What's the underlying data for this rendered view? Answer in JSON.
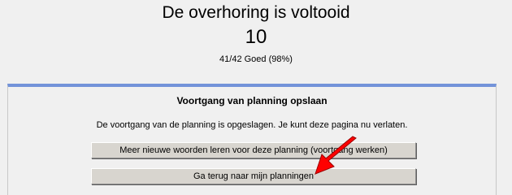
{
  "result": {
    "title": "De overhoring is voltooid",
    "score": "10",
    "summary": "41/42 Goed (98%)"
  },
  "panel": {
    "title": "Voortgang van planning opslaan",
    "message": "De voortgang van de planning is opgeslagen. Je kunt deze pagina nu verlaten.",
    "learn_more_button": "Meer nieuwe woorden leren voor deze planning (voortgang werken)",
    "back_button": "Ga terug naar mijn planningen"
  },
  "annotation": {
    "arrow_color": "#ff0000"
  },
  "colors": {
    "panel_accent": "#7393d9"
  }
}
